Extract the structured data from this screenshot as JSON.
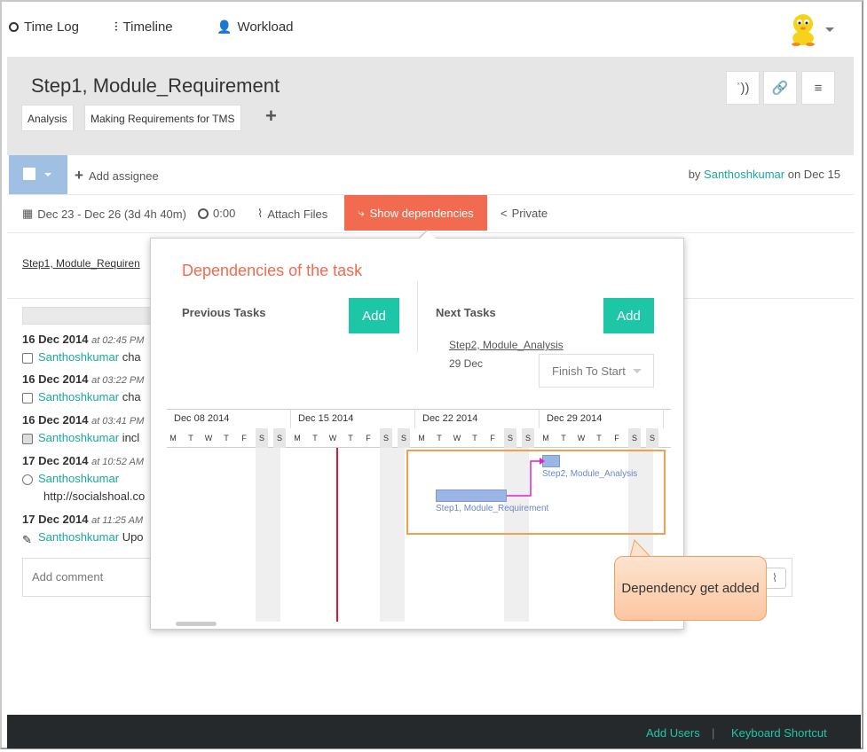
{
  "topnav": {
    "items": [
      {
        "label": "Time Log",
        "icon": "clock-icon"
      },
      {
        "label": "Timeline",
        "icon": "sliders-icon"
      },
      {
        "label": "Workload",
        "icon": "user-icon"
      }
    ]
  },
  "task": {
    "title": "Step1, Module_Requirement",
    "tags": [
      "Analysis",
      "Making Requirements for TMS"
    ]
  },
  "assign": {
    "add_assignee": "Add assignee",
    "by_prefix": "by",
    "author": "Santhoshkumar",
    "on_date": "on Dec 15"
  },
  "meta": {
    "dates": "Dec 23 - Dec 26 (3d 4h 40m)",
    "time": "0:00",
    "attach": "Attach Files",
    "show_dependencies": "Show dependencies",
    "private": "Private"
  },
  "description_link": "Step1, Module_Requiren",
  "activity": [
    {
      "date": "16 Dec 2014",
      "time": "at 02:45 PM",
      "user": "Santhoshkumar",
      "text": "cha"
    },
    {
      "date": "16 Dec 2014",
      "time": "at 03:22 PM",
      "user": "Santhoshkumar",
      "text": "cha"
    },
    {
      "date": "16 Dec 2014",
      "time": "at 03:41 PM",
      "user": "Santhoshkumar",
      "text": "incl"
    },
    {
      "date": "17 Dec 2014",
      "time": "at 10:52 AM",
      "user": "Santhoshkumar",
      "text": "http://socialshoal.co"
    },
    {
      "date": "17 Dec 2014",
      "time": "at 11:25 AM",
      "user": "Santhoshkumar",
      "text": "Upo"
    }
  ],
  "comment_placeholder": "Add comment",
  "dependencies": {
    "title": "Dependencies of the task",
    "previous_label": "Previous Tasks",
    "next_label": "Next Tasks",
    "add_label": "Add",
    "next_task_name": "Step2, Module_Analysis",
    "next_task_date": "29 Dec",
    "relation": "Finish To Start"
  },
  "gantt": {
    "weeks": [
      "Dec 08 2014",
      "Dec 15 2014",
      "Dec 22 2014",
      "Dec 29 2014"
    ],
    "days": [
      "M",
      "T",
      "W",
      "T",
      "F",
      "S",
      "S"
    ],
    "bars": [
      {
        "label": "Step1, Module_Requirement",
        "start_day": "Dec 23",
        "end_day": "Dec 28"
      },
      {
        "label": "Step2, Module_Analysis",
        "start_day": "Dec 29",
        "end_day": "Dec 29"
      }
    ],
    "today_marker": "Dec 18"
  },
  "callout": {
    "text": "Dependency get added"
  },
  "footer": {
    "add_users": "Add Users",
    "separator": "|",
    "keyboard": "Keyboard Shortcut"
  },
  "colors": {
    "accent_orange": "#f26a4f",
    "teal": "#1aa89a",
    "button_green": "#1ec6a8",
    "bar_blue": "#9bb5e6",
    "dependency_line": "#e020c8"
  }
}
